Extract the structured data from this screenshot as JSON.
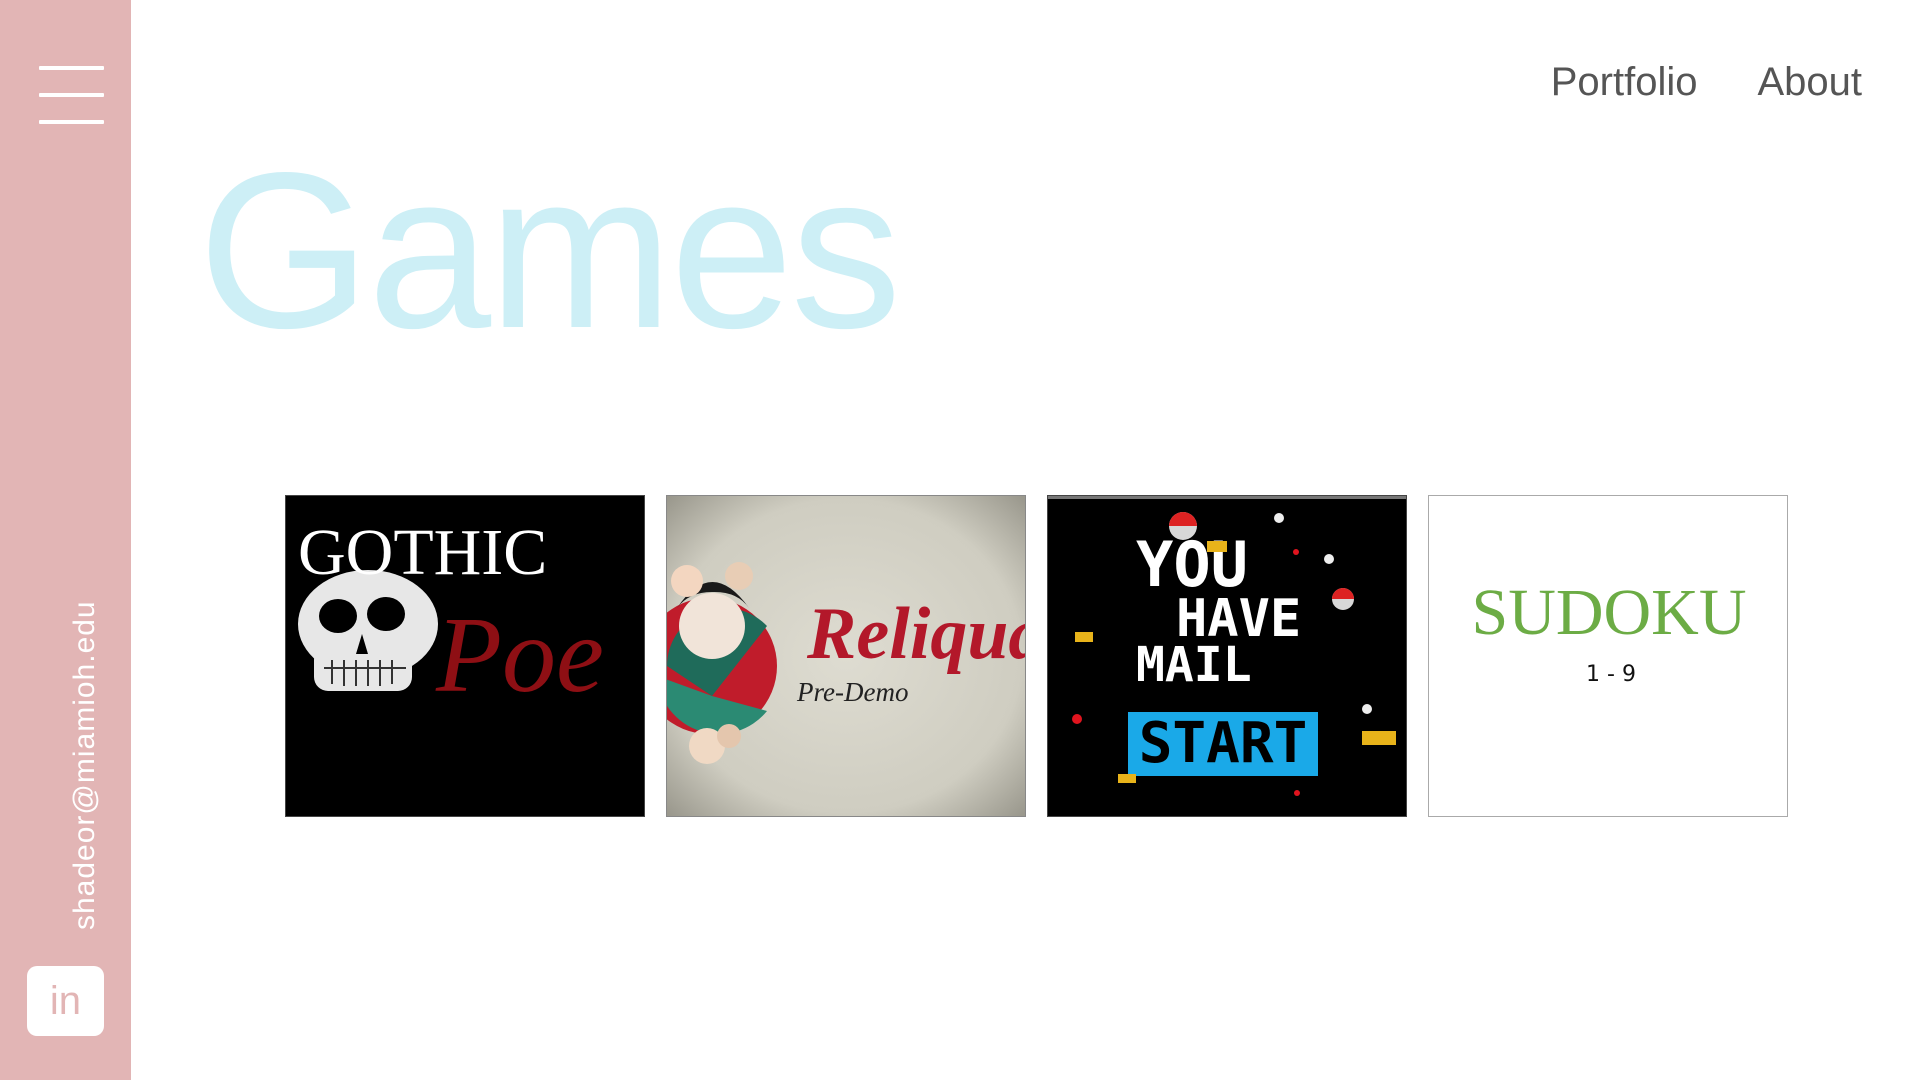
{
  "sidebar": {
    "email": "shadeor@miamioh.edu",
    "linkedin_label": "in"
  },
  "nav": {
    "items": [
      "Portfolio",
      "About"
    ]
  },
  "page": {
    "title": "Games"
  },
  "games": [
    {
      "title_line1": "GOTHIC",
      "title_line2": "Poe"
    },
    {
      "title": "Reliqua",
      "subtitle": "Pre-Demo"
    },
    {
      "line1": "YOU",
      "line2": "HAVE",
      "line3": "MAIL",
      "start_label": "START"
    },
    {
      "title": "SUDOKU",
      "subtitle": "1 - 9"
    }
  ],
  "colors": {
    "sidebar": "#e2b5b5",
    "title": "#cdeff6",
    "nav_text": "#555555",
    "sudoku_green": "#6cac45",
    "poe_red": "#8e0f14",
    "reliqua_red": "#b3182a",
    "start_blue": "#1aa9e8"
  }
}
